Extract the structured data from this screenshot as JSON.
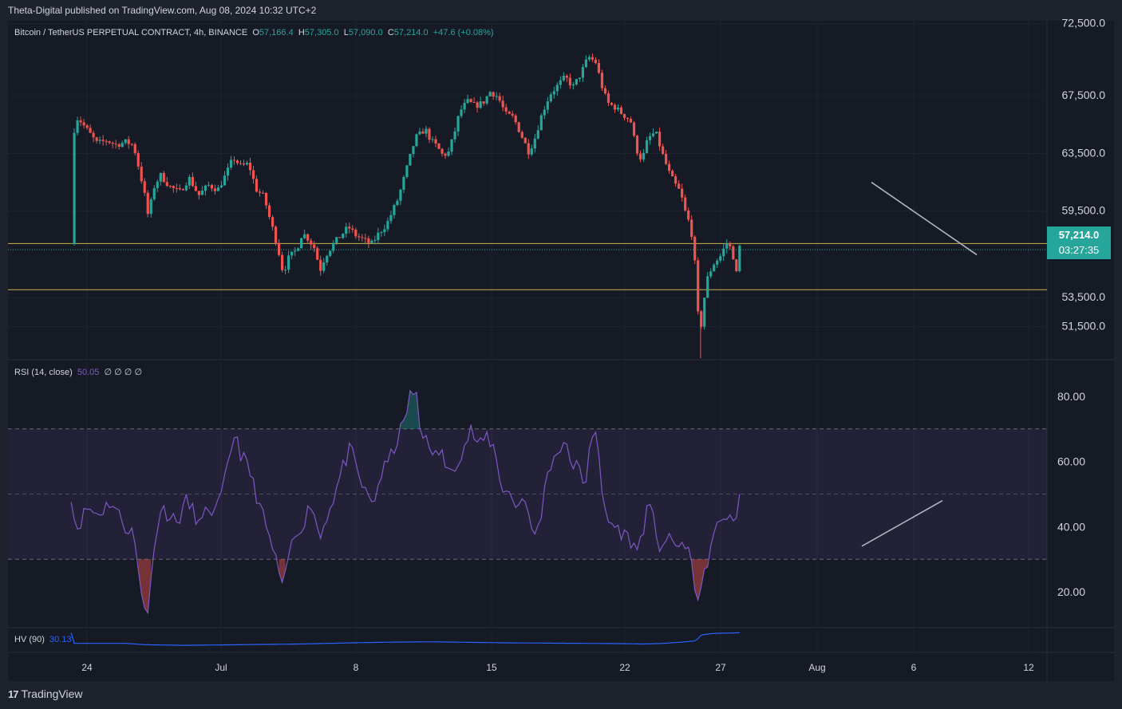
{
  "header": {
    "published": "Theta-Digital published on TradingView.com, Aug 08, 2024 10:32 UTC+2"
  },
  "symbol": {
    "name": "Bitcoin / TetherUS PERPETUAL CONTRACT, 4h, BINANCE",
    "open_label": "O",
    "open": "57,166.4",
    "high_label": "H",
    "high": "57,305.0",
    "low_label": "L",
    "low": "57,090.0",
    "close_label": "C",
    "close": "57,214.0",
    "change": "+47.6 (+0.08%)"
  },
  "price_badge": {
    "price": "57,214.0",
    "countdown": "03:27:35"
  },
  "rsi_legend": {
    "name": "RSI (14, close)",
    "value": "50.05",
    "extra": "∅ ∅ ∅ ∅"
  },
  "hv_legend": {
    "name": "HV (90)",
    "value": "30.13"
  },
  "brand": {
    "name": "TradingView",
    "logo": "17"
  },
  "colors": {
    "up": "#26a69a",
    "down": "#ef5350",
    "rsi": "#7e57c2",
    "hv": "#2962ff",
    "level": "#c9b24a",
    "trendline": "#b2b5be",
    "background": "#161a25"
  },
  "chart_data": [
    {
      "type": "candlestick",
      "title": "Bitcoin / TetherUS PERPETUAL CONTRACT, 4h, BINANCE",
      "x_ticks": [
        "24",
        "Jul",
        "8",
        "15",
        "22",
        "27",
        "Aug",
        "6",
        "12"
      ],
      "y_ticks": [
        "72,500.0",
        "67,500.0",
        "63,500.0",
        "59,500.0",
        "53,500.0",
        "51,500.0"
      ],
      "ylim": [
        49200,
        72700
      ],
      "horizontal_levels": [
        57250,
        54050
      ],
      "last_price": 57214.0,
      "trendline": [
        [
          61500,
          56750
        ]
      ],
      "anchors_day_price": [
        [
          -0.8,
          64600
        ],
        [
          -0.5,
          66000
        ],
        [
          0.0,
          65100
        ],
        [
          0.5,
          64200
        ],
        [
          1.0,
          64400
        ],
        [
          1.5,
          64100
        ],
        [
          2.0,
          64300
        ],
        [
          2.4,
          64100
        ],
        [
          2.8,
          61800
        ],
        [
          3.0,
          60500
        ],
        [
          3.2,
          58900
        ],
        [
          3.4,
          61000
        ],
        [
          3.8,
          62000
        ],
        [
          4.3,
          61200
        ],
        [
          4.8,
          60800
        ],
        [
          5.3,
          61800
        ],
        [
          5.8,
          60600
        ],
        [
          6.3,
          61300
        ],
        [
          6.8,
          61000
        ],
        [
          7.2,
          62000
        ],
        [
          7.6,
          63200
        ],
        [
          8.0,
          62600
        ],
        [
          8.4,
          62800
        ],
        [
          8.8,
          61000
        ],
        [
          9.2,
          60500
        ],
        [
          9.5,
          59000
        ],
        [
          9.8,
          57600
        ],
        [
          10.0,
          56500
        ],
        [
          10.2,
          55200
        ],
        [
          10.5,
          56300
        ],
        [
          10.9,
          56800
        ],
        [
          11.2,
          58000
        ],
        [
          11.5,
          57600
        ],
        [
          11.9,
          56800
        ],
        [
          12.1,
          55300
        ],
        [
          12.4,
          56400
        ],
        [
          12.8,
          57200
        ],
        [
          13.2,
          57800
        ],
        [
          13.6,
          58400
        ],
        [
          14.0,
          57800
        ],
        [
          14.4,
          57500
        ],
        [
          14.8,
          57200
        ],
        [
          15.2,
          58000
        ],
        [
          15.6,
          58600
        ],
        [
          15.9,
          59500
        ],
        [
          16.2,
          60400
        ],
        [
          16.5,
          61800
        ],
        [
          16.8,
          63200
        ],
        [
          17.1,
          64600
        ],
        [
          17.3,
          64800
        ],
        [
          17.6,
          65200
        ],
        [
          17.9,
          64400
        ],
        [
          18.2,
          64000
        ],
        [
          18.5,
          63400
        ],
        [
          18.8,
          63500
        ],
        [
          19.1,
          64800
        ],
        [
          19.4,
          66400
        ],
        [
          19.8,
          67100
        ],
        [
          20.2,
          66800
        ],
        [
          20.6,
          67000
        ],
        [
          21.0,
          67800
        ],
        [
          21.4,
          67400
        ],
        [
          21.8,
          66200
        ],
        [
          22.2,
          66000
        ],
        [
          22.6,
          64800
        ],
        [
          23.0,
          63600
        ],
        [
          23.3,
          64500
        ],
        [
          23.7,
          66300
        ],
        [
          24.1,
          67600
        ],
        [
          24.5,
          68200
        ],
        [
          24.9,
          68800
        ],
        [
          25.3,
          68100
        ],
        [
          25.7,
          69000
        ],
        [
          26.1,
          70200
        ],
        [
          26.5,
          69800
        ],
        [
          26.8,
          68200
        ],
        [
          27.1,
          67000
        ],
        [
          27.5,
          66700
        ],
        [
          27.9,
          66200
        ],
        [
          28.3,
          65800
        ],
        [
          28.6,
          63800
        ],
        [
          28.9,
          63000
        ],
        [
          29.2,
          64500
        ],
        [
          29.6,
          65000
        ],
        [
          30.0,
          63300
        ],
        [
          30.3,
          62200
        ],
        [
          30.6,
          61400
        ],
        [
          30.9,
          60800
        ],
        [
          31.2,
          59200
        ],
        [
          31.4,
          58600
        ],
        [
          31.6,
          57000
        ],
        [
          31.8,
          52500
        ],
        [
          31.95,
          51200
        ],
        [
          32.1,
          53100
        ],
        [
          32.3,
          54800
        ],
        [
          32.6,
          55800
        ],
        [
          33.0,
          56400
        ],
        [
          33.3,
          57300
        ],
        [
          33.6,
          56800
        ],
        [
          33.8,
          55000
        ],
        [
          34.0,
          57214
        ]
      ]
    },
    {
      "type": "line",
      "title": "RSI (14, close)",
      "y_ticks": [
        "80.00",
        "60.00",
        "40.00",
        "20.00"
      ],
      "ylim": [
        9,
        91
      ],
      "band": [
        30,
        70
      ],
      "midline": 50,
      "anchors_day_value": [
        [
          -0.8,
          44
        ],
        [
          -0.5,
          40
        ],
        [
          0.0,
          46
        ],
        [
          0.4,
          44
        ],
        [
          0.8,
          45
        ],
        [
          1.2,
          48
        ],
        [
          1.6,
          44
        ],
        [
          2.0,
          40
        ],
        [
          2.4,
          38
        ],
        [
          2.8,
          20
        ],
        [
          3.0,
          16
        ],
        [
          3.2,
          14
        ],
        [
          3.5,
          37
        ],
        [
          3.9,
          46
        ],
        [
          4.3,
          43
        ],
        [
          4.7,
          41
        ],
        [
          5.1,
          48
        ],
        [
          5.5,
          45
        ],
        [
          5.9,
          40
        ],
        [
          6.3,
          46
        ],
        [
          6.7,
          44
        ],
        [
          7.1,
          52
        ],
        [
          7.4,
          61
        ],
        [
          7.7,
          70
        ],
        [
          8.0,
          62
        ],
        [
          8.4,
          58
        ],
        [
          8.8,
          50
        ],
        [
          9.2,
          42
        ],
        [
          9.6,
          34
        ],
        [
          10.0,
          26
        ],
        [
          10.2,
          19
        ],
        [
          10.5,
          32
        ],
        [
          10.9,
          38
        ],
        [
          11.3,
          42
        ],
        [
          11.7,
          48
        ],
        [
          12.1,
          36
        ],
        [
          12.5,
          44
        ],
        [
          12.9,
          50
        ],
        [
          13.3,
          58
        ],
        [
          13.7,
          64
        ],
        [
          14.1,
          56
        ],
        [
          14.5,
          50
        ],
        [
          14.9,
          47
        ],
        [
          15.3,
          56
        ],
        [
          15.7,
          60
        ],
        [
          16.1,
          66
        ],
        [
          16.5,
          72
        ],
        [
          16.8,
          80
        ],
        [
          17.1,
          82
        ],
        [
          17.4,
          66
        ],
        [
          17.7,
          70
        ],
        [
          18.0,
          60
        ],
        [
          18.4,
          64
        ],
        [
          18.8,
          56
        ],
        [
          19.2,
          60
        ],
        [
          19.6,
          64
        ],
        [
          20.0,
          70
        ],
        [
          20.4,
          64
        ],
        [
          20.8,
          68
        ],
        [
          21.2,
          64
        ],
        [
          21.6,
          52
        ],
        [
          22.0,
          50
        ],
        [
          22.4,
          46
        ],
        [
          22.8,
          50
        ],
        [
          23.2,
          36
        ],
        [
          23.6,
          42
        ],
        [
          24.0,
          58
        ],
        [
          24.4,
          62
        ],
        [
          24.8,
          66
        ],
        [
          25.2,
          60
        ],
        [
          25.6,
          58
        ],
        [
          25.9,
          50
        ],
        [
          26.2,
          68
        ],
        [
          26.5,
          70
        ],
        [
          26.8,
          50
        ],
        [
          27.1,
          42
        ],
        [
          27.5,
          40
        ],
        [
          27.9,
          38
        ],
        [
          28.3,
          36
        ],
        [
          28.6,
          32
        ],
        [
          28.9,
          38
        ],
        [
          29.2,
          46
        ],
        [
          29.5,
          42
        ],
        [
          29.8,
          34
        ],
        [
          30.2,
          36
        ],
        [
          30.6,
          34
        ],
        [
          30.9,
          36
        ],
        [
          31.2,
          32
        ],
        [
          31.5,
          30
        ],
        [
          31.7,
          20
        ],
        [
          31.9,
          16
        ],
        [
          32.1,
          24
        ],
        [
          32.4,
          32
        ],
        [
          32.7,
          38
        ],
        [
          33.0,
          42
        ],
        [
          33.3,
          44
        ],
        [
          33.6,
          40
        ],
        [
          33.8,
          44
        ],
        [
          34.0,
          50
        ]
      ],
      "divergence_line": [
        [
          34,
          48
        ]
      ]
    },
    {
      "type": "line",
      "title": "HV (90)",
      "last_value": 30.13,
      "anchors_day_value": [
        [
          -0.8,
          22
        ],
        [
          2.0,
          22
        ],
        [
          3.0,
          21
        ],
        [
          5.0,
          20.5
        ],
        [
          8.0,
          21
        ],
        [
          11.0,
          21.5
        ],
        [
          14.0,
          22.5
        ],
        [
          16.0,
          23
        ],
        [
          18.0,
          23.2
        ],
        [
          20.0,
          22.8
        ],
        [
          22.0,
          22.4
        ],
        [
          24.0,
          22.2
        ],
        [
          26.0,
          22.0
        ],
        [
          28.0,
          21.8
        ],
        [
          29.0,
          21.5
        ],
        [
          30.0,
          22.0
        ],
        [
          31.0,
          23.0
        ],
        [
          31.7,
          24.0
        ],
        [
          32.0,
          28.5
        ],
        [
          32.5,
          29.5
        ],
        [
          33.0,
          29.8
        ],
        [
          34.0,
          30.13
        ]
      ]
    }
  ]
}
